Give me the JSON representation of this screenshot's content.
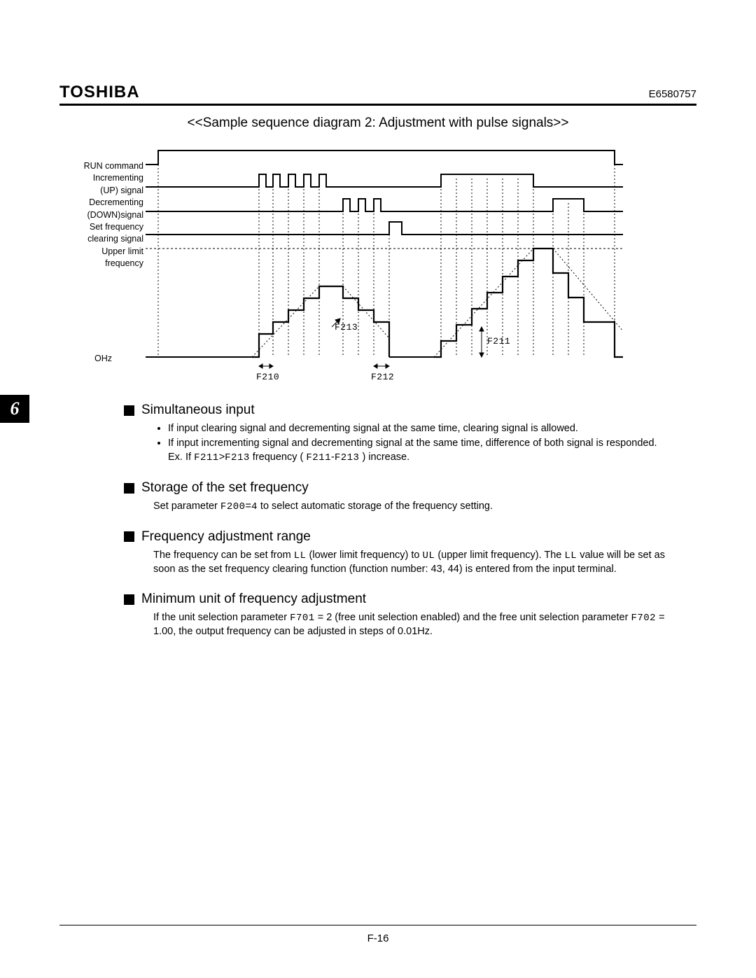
{
  "header": {
    "brand": "TOSHIBA",
    "doc_number": "E6580757"
  },
  "section_tab": "6",
  "diagram": {
    "title": "<<Sample sequence diagram 2: Adjustment with pulse signals>>",
    "signal_labels": {
      "run": "RUN command",
      "up_l1": "Incrementing",
      "up_l2": "(UP) signal",
      "down_l1": "Decrementing",
      "down_l2": "(DOWN)signal",
      "clr_l1": "Set frequency",
      "clr_l2": "clearing signal",
      "ul_l1": "Upper limit",
      "ul_l2": "frequency",
      "ohz": "OHz"
    },
    "param_labels": {
      "f210": "F210",
      "f211": "F211",
      "f212": "F212",
      "f213": "F213"
    }
  },
  "sections": {
    "simultaneous": {
      "heading": "Simultaneous input",
      "bullet1": "If input clearing signal and decrementing signal at the same time, clearing signal is allowed.",
      "bullet2": "If input incrementing signal and decrementing signal at the same time, difference of both signal is responded.",
      "ex_prefix": "Ex. If ",
      "ex_a": "F211",
      "ex_gt": ">",
      "ex_b": "F213",
      "ex_mid": " frequency ( ",
      "ex_c": "F211",
      "ex_dash": "-",
      "ex_d": "F213",
      "ex_suffix": " ) increase."
    },
    "storage": {
      "heading": "Storage of the set frequency",
      "body_pre": "Set parameter ",
      "param": "F200",
      "eq": "=",
      "val": "4",
      "body_post": " to select automatic storage of the frequency setting."
    },
    "range": {
      "heading": "Frequency adjustment range",
      "t1": "The frequency can be set from ",
      "ll": "LL",
      "t2": " (lower limit frequency) to ",
      "ul": "UL",
      "t3": " (upper limit frequency).  The ",
      "ll2": "LL",
      "t4": " value will be set as soon as the set frequency clearing function (function number: 43, 44) is entered from the input terminal."
    },
    "minunit": {
      "heading": "Minimum unit of frequency adjustment",
      "t1": "If the unit selection parameter ",
      "p1": "F701",
      "t2": " = 2 (free unit selection enabled) and the free unit selection parameter ",
      "p2": "F702",
      "t3": " = 1.00, the output frequency can be adjusted in steps of 0.01Hz."
    }
  },
  "footer": {
    "page": "F-16"
  }
}
